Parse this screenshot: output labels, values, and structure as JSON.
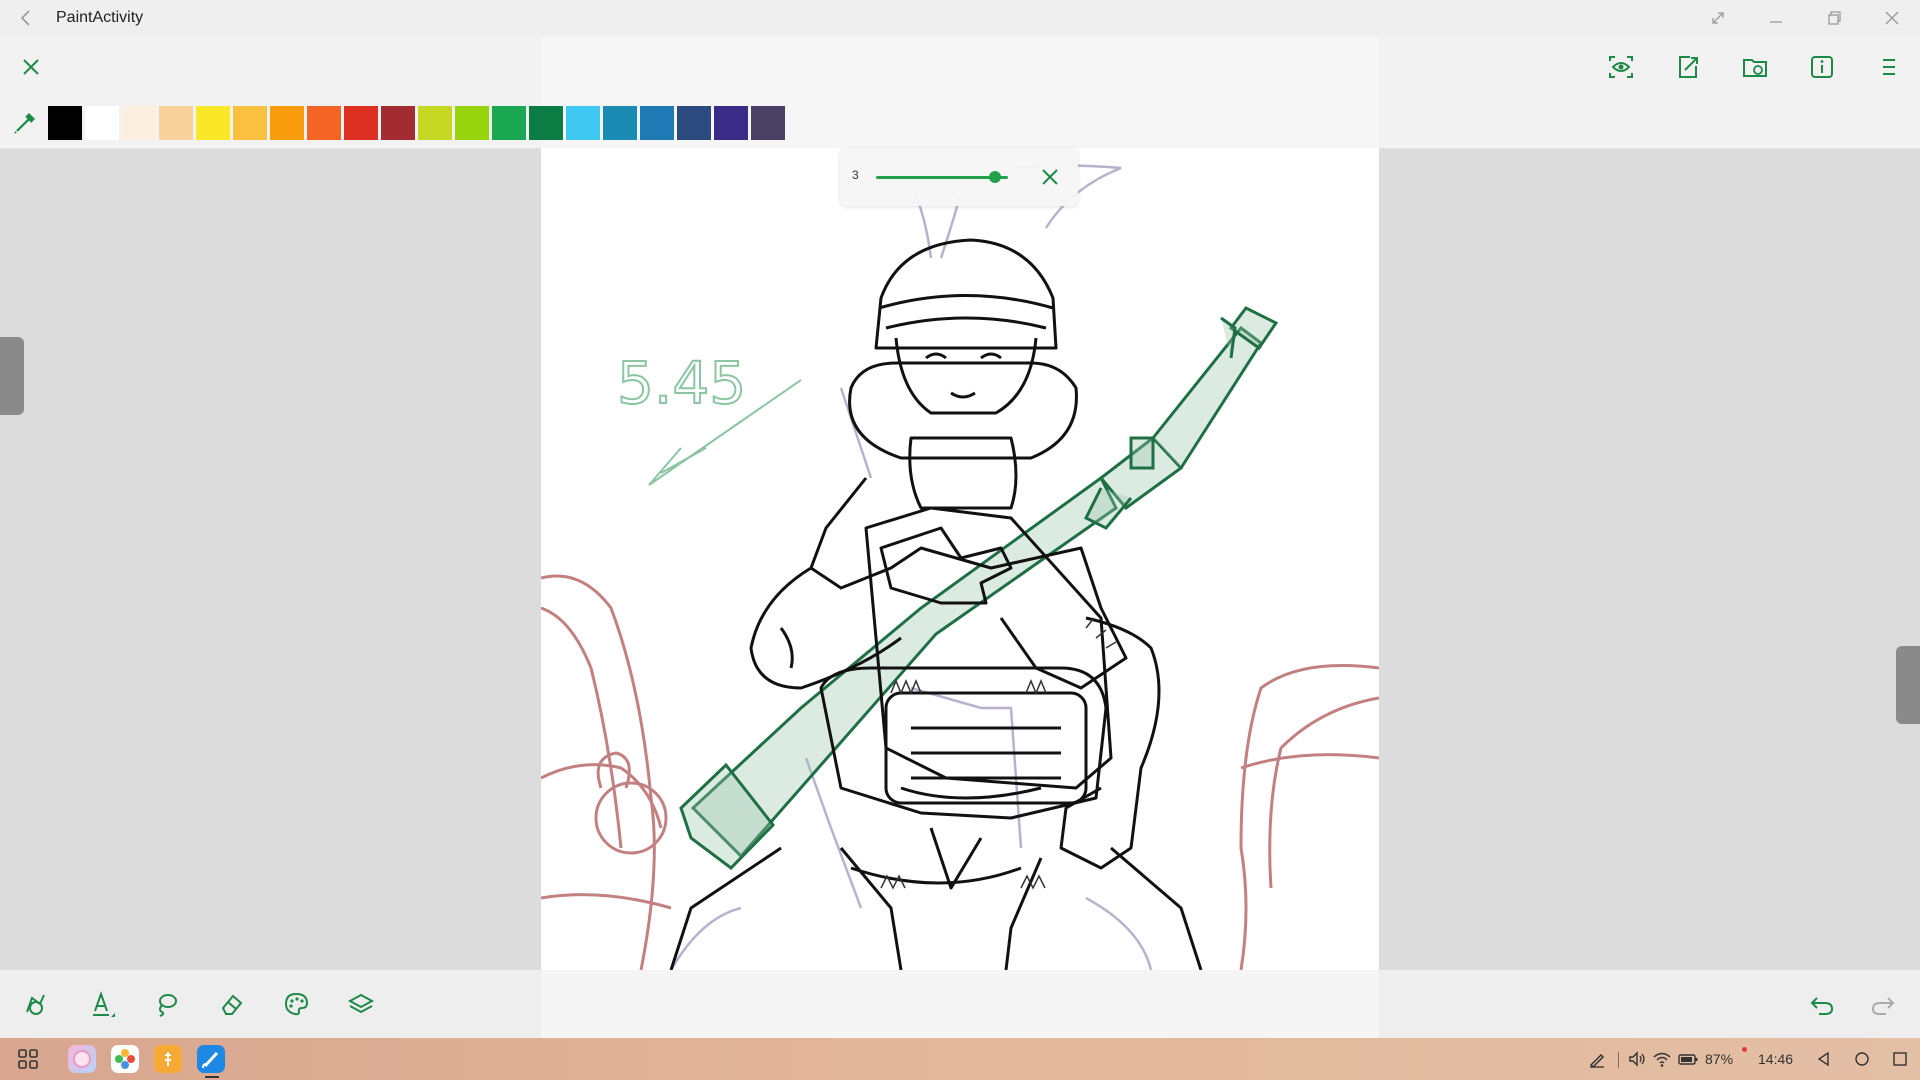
{
  "window": {
    "title": "PaintActivity",
    "controls": [
      "maximize-expand-icon",
      "minimize-icon",
      "restore-icon",
      "close-icon"
    ]
  },
  "toolbar": {
    "left": [
      "close-icon"
    ],
    "right": [
      "preview-eye-icon",
      "export-icon",
      "open-folder-icon",
      "info-icon",
      "menu-icon"
    ]
  },
  "palette": {
    "picker_icon": "eyedropper-icon",
    "colors": [
      "#000000",
      "#ffffff",
      "#fdeee2",
      "#f9d19b",
      "#fae728",
      "#fac03f",
      "#f99d0e",
      "#f46525",
      "#dd2f22",
      "#a22c32",
      "#c6d823",
      "#97d40c",
      "#1ba751",
      "#0b7c44",
      "#3fc9f2",
      "#1a8cb3",
      "#1f79b5",
      "#2b4b7e",
      "#3a2b86",
      "#4a4166"
    ]
  },
  "brush_size": {
    "value": "3",
    "fraction": 0.9
  },
  "canvas": {
    "annotation_text": "5.45",
    "accent_green": "#1d7a42"
  },
  "bottom_tools": [
    "shapes-icon",
    "pen-icon",
    "lasso-icon",
    "eraser-icon",
    "palette-icon",
    "layers-icon"
  ],
  "history": [
    "undo-icon",
    "redo-icon"
  ],
  "taskbar": {
    "apps": [
      "app-launcher-icon",
      "gallery-app-icon",
      "photos-app-icon",
      "files-app-icon",
      "paint-app-icon"
    ],
    "battery": "87%",
    "time": "14:46",
    "nav": [
      "back-nav-icon",
      "home-nav-icon",
      "recents-nav-icon"
    ]
  }
}
